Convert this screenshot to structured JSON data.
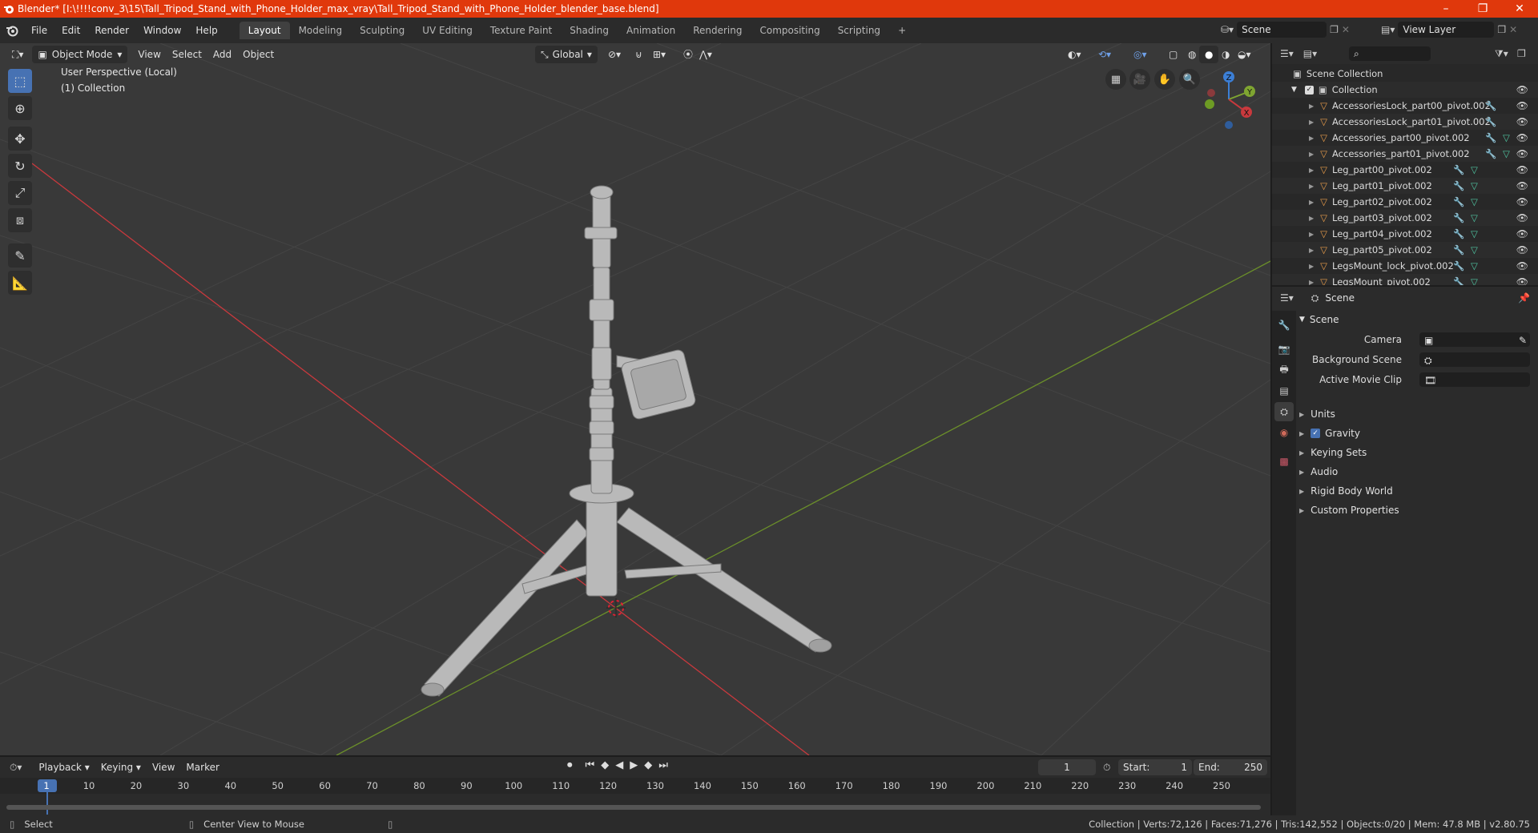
{
  "window": {
    "title": "Blender* [I:\\!!!!conv_3\\15\\Tall_Tripod_Stand_with_Phone_Holder_max_vray\\Tall_Tripod_Stand_with_Phone_Holder_blender_base.blend]",
    "minimize": "–",
    "maximize": "❐",
    "close": "✕"
  },
  "menu": [
    "File",
    "Edit",
    "Render",
    "Window",
    "Help"
  ],
  "workspaces": [
    "Layout",
    "Modeling",
    "Sculpting",
    "UV Editing",
    "Texture Paint",
    "Shading",
    "Animation",
    "Rendering",
    "Compositing",
    "Scripting"
  ],
  "workspace_add": "+",
  "scene_field": "Scene",
  "view_layer_field": "View Layer",
  "viewport": {
    "mode": "Object Mode",
    "menus": [
      "View",
      "Select",
      "Add",
      "Object"
    ],
    "orientation": "Global",
    "overlay_line1": "User Perspective (Local)",
    "overlay_line2": "(1) Collection",
    "gizmo": {
      "x": "X",
      "y": "Y",
      "z": "Z"
    }
  },
  "outliner": {
    "root": "Scene Collection",
    "collection": "Collection",
    "items": [
      "AccessoriesLock_part00_pivot.002",
      "AccessoriesLock_part01_pivot.002",
      "Accessories_part00_pivot.002",
      "Accessories_part01_pivot.002",
      "Leg_part00_pivot.002",
      "Leg_part01_pivot.002",
      "Leg_part02_pivot.002",
      "Leg_part03_pivot.002",
      "Leg_part04_pivot.002",
      "Leg_part05_pivot.002",
      "LegsMount_lock_pivot.002",
      "LegsMount_pivot.002"
    ]
  },
  "properties": {
    "header": "Scene",
    "panel": "Scene",
    "camera_label": "Camera",
    "background_scene_label": "Background Scene",
    "active_movie_clip_label": "Active Movie Clip",
    "sections": [
      "Units",
      "Gravity",
      "Keying Sets",
      "Audio",
      "Rigid Body World",
      "Custom Properties"
    ]
  },
  "timeline": {
    "menus": [
      "Playback",
      "Keying",
      "View",
      "Marker"
    ],
    "current_frame": "1",
    "start_label": "Start:",
    "start": "1",
    "end_label": "End:",
    "end": "250",
    "ticks": [
      "1",
      "10",
      "20",
      "30",
      "40",
      "50",
      "60",
      "70",
      "80",
      "90",
      "100",
      "110",
      "120",
      "130",
      "140",
      "150",
      "160",
      "170",
      "180",
      "190",
      "200",
      "210",
      "220",
      "230",
      "240",
      "250"
    ]
  },
  "status": {
    "select": "Select",
    "center_view": "Center View to Mouse",
    "stats": "Collection | Verts:72,126 | Faces:71,276 | Tris:142,552 | Objects:0/20 | Mem: 47.8 MB | v2.80.75"
  },
  "colors": {
    "accent": "#4772b3",
    "titlebar": "#e0380c",
    "x_axis": "#c9393d",
    "y_axis": "#7fa531",
    "z_axis": "#3c7fd6"
  }
}
